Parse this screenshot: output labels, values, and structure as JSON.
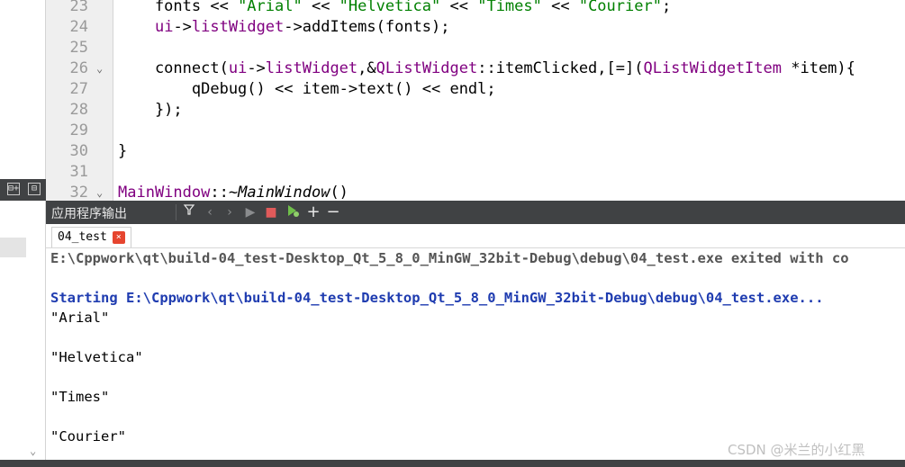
{
  "editor": {
    "lines": [
      {
        "num": "23",
        "fold": "",
        "html_parts": [
          {
            "t": "    fonts << ",
            "c": ""
          },
          {
            "t": "\"Arial\"",
            "c": "k-str"
          },
          {
            "t": " << ",
            "c": ""
          },
          {
            "t": "\"Helvetica\"",
            "c": "k-str"
          },
          {
            "t": " << ",
            "c": ""
          },
          {
            "t": "\"Times\"",
            "c": "k-str"
          },
          {
            "t": " << ",
            "c": ""
          },
          {
            "t": "\"Courier\"",
            "c": "k-str"
          },
          {
            "t": ";",
            "c": ""
          }
        ]
      },
      {
        "num": "24",
        "fold": "",
        "html_parts": [
          {
            "t": "    ",
            "c": ""
          },
          {
            "t": "ui",
            "c": "k-mem"
          },
          {
            "t": "->",
            "c": ""
          },
          {
            "t": "listWidget",
            "c": "k-mem"
          },
          {
            "t": "->addItems(fonts);",
            "c": ""
          }
        ]
      },
      {
        "num": "25",
        "fold": "",
        "html_parts": []
      },
      {
        "num": "26",
        "fold": "⌄",
        "html_parts": [
          {
            "t": "    connect(",
            "c": ""
          },
          {
            "t": "ui",
            "c": "k-mem"
          },
          {
            "t": "->",
            "c": ""
          },
          {
            "t": "listWidget",
            "c": "k-mem"
          },
          {
            "t": ",&",
            "c": ""
          },
          {
            "t": "QListWidget",
            "c": "k-cls"
          },
          {
            "t": "::itemClicked,[=](",
            "c": ""
          },
          {
            "t": "QListWidgetItem",
            "c": "k-cls"
          },
          {
            "t": " *item){",
            "c": ""
          }
        ]
      },
      {
        "num": "27",
        "fold": "",
        "html_parts": [
          {
            "t": "        qDebug() << item->text() << endl;",
            "c": ""
          }
        ]
      },
      {
        "num": "28",
        "fold": "",
        "html_parts": [
          {
            "t": "    });",
            "c": ""
          }
        ]
      },
      {
        "num": "29",
        "fold": "",
        "html_parts": []
      },
      {
        "num": "30",
        "fold": "",
        "html_parts": [
          {
            "t": "}",
            "c": ""
          }
        ]
      },
      {
        "num": "31",
        "fold": "",
        "html_parts": []
      },
      {
        "num": "32",
        "fold": "⌄",
        "html_parts": [
          {
            "t": "MainWindow",
            "c": "k-cls"
          },
          {
            "t": "::",
            "c": ""
          },
          {
            "t": "~MainWindow",
            "c": "k-ital"
          },
          {
            "t": "()",
            "c": ""
          }
        ]
      }
    ]
  },
  "output_pane": {
    "title": "应用程序输出",
    "toolbar": {
      "filter_icon": "filter-icon",
      "prev_icon": "‹",
      "next_icon": "›",
      "run_icon": "▶",
      "stop_icon": "■",
      "debug_icon": "debug-run-icon",
      "add_icon": "+",
      "remove_icon": "−"
    },
    "tab": {
      "label": "04_test",
      "close_glyph": "×"
    },
    "lines": [
      {
        "text": "E:\\Cppwork\\qt\\build-04_test-Desktop_Qt_5_8_0_MinGW_32bit-Debug\\debug\\04_test.exe exited with co",
        "kind": "exit"
      },
      {
        "text": "",
        "kind": "plain"
      },
      {
        "text": "Starting E:\\Cppwork\\qt\\build-04_test-Desktop_Qt_5_8_0_MinGW_32bit-Debug\\debug\\04_test.exe...",
        "kind": "start"
      },
      {
        "text": "\"Arial\"",
        "kind": "plain"
      },
      {
        "text": "",
        "kind": "plain"
      },
      {
        "text": "\"Helvetica\"",
        "kind": "plain"
      },
      {
        "text": "",
        "kind": "plain"
      },
      {
        "text": "\"Times\"",
        "kind": "plain"
      },
      {
        "text": "",
        "kind": "plain"
      },
      {
        "text": "\"Courier\"",
        "kind": "plain"
      }
    ]
  },
  "left_panel": {
    "split_icon": "⊟+",
    "collapse_icon": "⊟",
    "scroll_down_glyph": "⌄"
  },
  "watermark": "CSDN @米兰的小红黑",
  "colors": {
    "string": "#008000",
    "member": "#800080",
    "starting": "#1f3cb0",
    "pane_header": "#404244",
    "tab_close": "#e6452f"
  }
}
